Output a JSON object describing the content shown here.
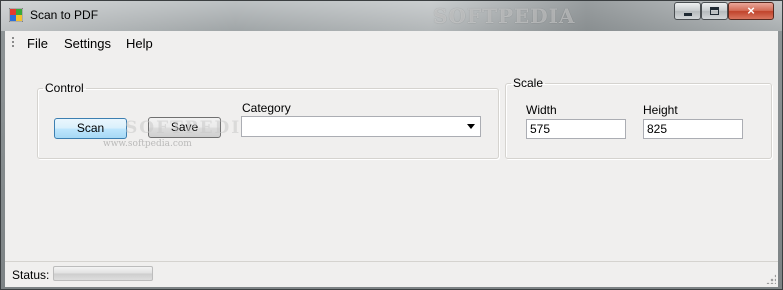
{
  "window": {
    "title": "Scan to PDF",
    "close_label": "×"
  },
  "watermark": {
    "title_text": "SOFTPEDIA",
    "overlay_text": "SOFTPEDIA",
    "url": "www.softpedia.com"
  },
  "menu": {
    "items": [
      "File",
      "Settings",
      "Help"
    ]
  },
  "control": {
    "legend": "Control",
    "scan_label": "Scan",
    "save_label": "Save",
    "category_label": "Category",
    "category_value": ""
  },
  "scale": {
    "legend": "Scale",
    "width_label": "Width",
    "width_value": "575",
    "height_label": "Height",
    "height_value": "825"
  },
  "status": {
    "label": "Status:",
    "progress": 0
  },
  "colors": {
    "accent_button": "#3c7fb1",
    "client_bg": "#f0efee"
  },
  "icons": [
    "app-icon",
    "minimize-icon",
    "maximize-icon",
    "close-icon",
    "dropdown-arrow-icon",
    "size-grip-icon"
  ]
}
